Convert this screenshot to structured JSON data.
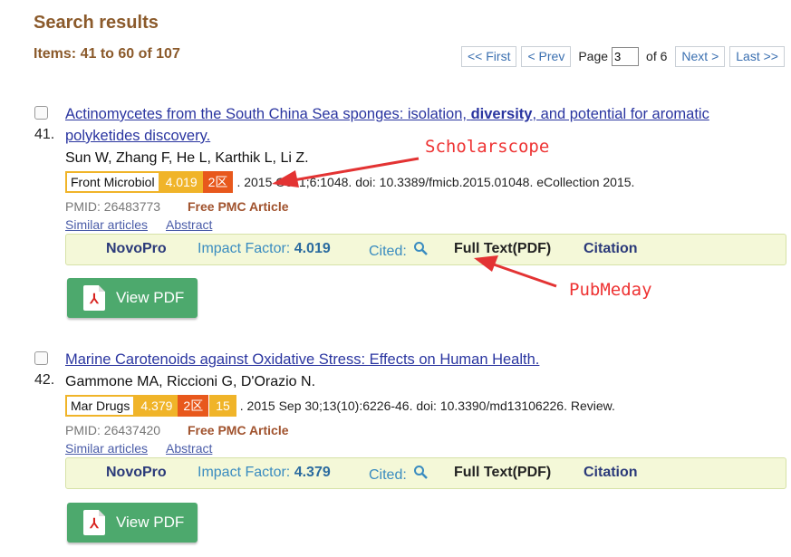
{
  "header": {
    "title": "Search results",
    "items_summary": "Items: 41 to 60 of 107"
  },
  "pager": {
    "first": "<< First",
    "prev": "< Prev",
    "page_label": "Page",
    "page_value": "3",
    "of_label": "of 6",
    "next": "Next >",
    "last": "Last >>"
  },
  "results": [
    {
      "number": "41.",
      "title_pre": "Actinomycetes from the South China Sea sponges: isolation, ",
      "title_bold": "diversity",
      "title_post": ", and potential for aromatic polyketides discovery.",
      "authors": "Sun W, Zhang F, He L, Karthik L, Li Z.",
      "journal": "Front Microbiol",
      "impact": "4.019",
      "quartile": "2区",
      "citation": ". 2015 Oct 1;6:1048. doi: 10.3389/fmicb.2015.01048. eCollection 2015.",
      "pmid": "PMID: 26483773",
      "free_pmc": "Free PMC Article",
      "similar": "Similar articles",
      "abstract": "Abstract",
      "toolbar": {
        "novopro": "NovoPro",
        "if_label": "Impact Factor: ",
        "if_value": "4.019",
        "cited": "Cited:",
        "fulltext": "Full Text(PDF)",
        "citation": "Citation"
      },
      "view_pdf": "View PDF"
    },
    {
      "number": "42.",
      "title": "Marine Carotenoids against Oxidative Stress: Effects on Human Health.",
      "authors": "Gammone MA, Riccioni G, D'Orazio N.",
      "journal": "Mar Drugs",
      "impact": "4.379",
      "quartile": "2区",
      "cites": "15",
      "citation": ". 2015 Sep 30;13(10):6226-46. doi: 10.3390/md13106226. Review.",
      "pmid": "PMID: 26437420",
      "free_pmc": "Free PMC Article",
      "similar": "Similar articles",
      "abstract": "Abstract",
      "toolbar": {
        "novopro": "NovoPro",
        "if_label": "Impact Factor: ",
        "if_value": "4.379",
        "cited": "Cited:",
        "fulltext": "Full Text(PDF)",
        "citation": "Citation"
      },
      "view_pdf": "View PDF"
    }
  ],
  "annotations": {
    "scholarscope": "Scholarscope",
    "pubmeday": "PubMeday",
    "color": "#e33333"
  },
  "icons": {
    "cited": "search-icon",
    "pdf": "pdf-icon",
    "checkbox": "checkbox"
  }
}
